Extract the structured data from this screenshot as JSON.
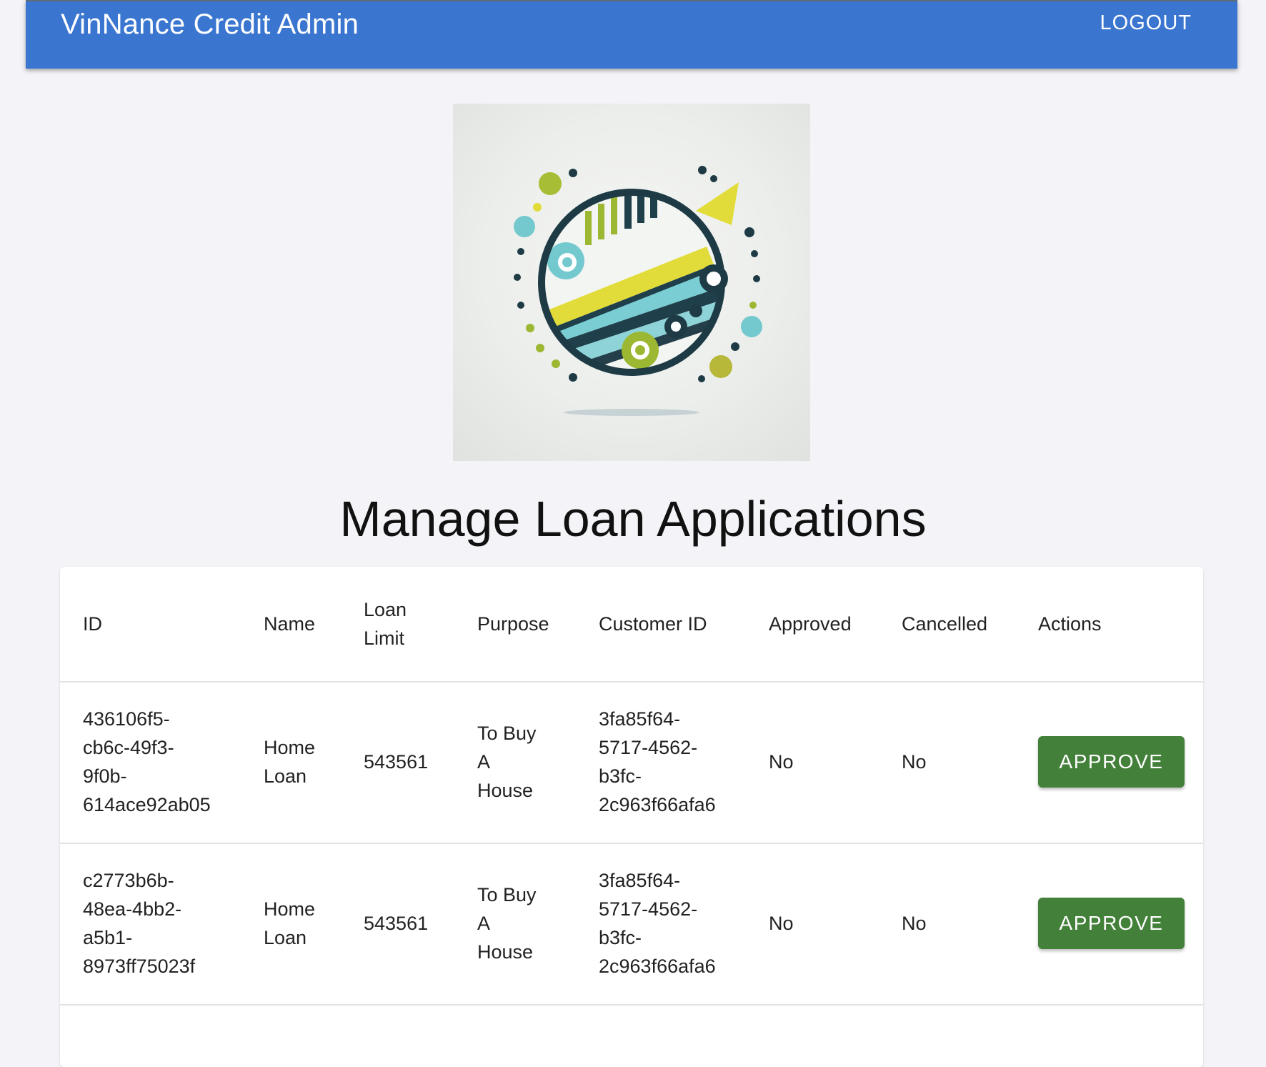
{
  "appbar": {
    "title": "VinNance Credit Admin",
    "logout_label": "LOGOUT",
    "color": "#3a76d0"
  },
  "logo": {
    "icon": "finance-growth-logo-icon"
  },
  "main": {
    "title": "Manage Loan Applications"
  },
  "table": {
    "headers": {
      "id": "ID",
      "name": "Name",
      "loan_limit": "Loan\nLimit",
      "purpose": "Purpose",
      "customer_id": "Customer ID",
      "approved": "Approved",
      "cancelled": "Cancelled",
      "actions": "Actions"
    },
    "rows": [
      {
        "id": "436106f5-\ncb6c-49f3-\n9f0b-\n614ace92ab05",
        "name": "Home\nLoan",
        "loan_limit": "543561",
        "purpose": "To Buy\nA\nHouse",
        "customer_id": "3fa85f64-\n5717-4562-\nb3fc-\n2c963f66afa6",
        "approved": "No",
        "cancelled": "No",
        "action_label": "APPROVE"
      },
      {
        "id": "c2773b6b-\n48ea-4bb2-\na5b1-\n8973ff75023f",
        "name": "Home\nLoan",
        "loan_limit": "543561",
        "purpose": "To Buy\nA\nHouse",
        "customer_id": "3fa85f64-\n5717-4562-\nb3fc-\n2c963f66afa6",
        "approved": "No",
        "cancelled": "No",
        "action_label": "APPROVE"
      }
    ],
    "approve_color": "#43803a"
  }
}
